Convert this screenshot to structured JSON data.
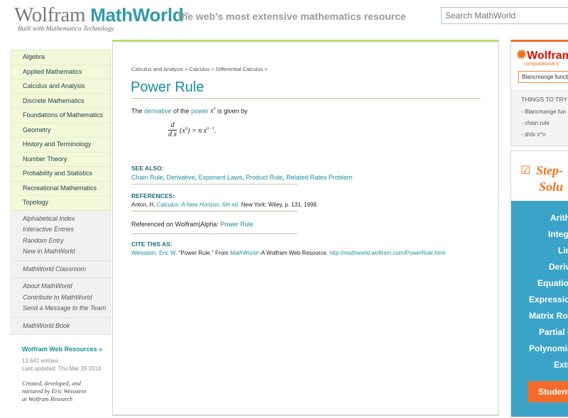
{
  "header": {
    "logo_wolfram": "Wolfram",
    "logo_mathworld": "MathW",
    "logo_mathworld_o": "o",
    "logo_mathworld_rest": "rld",
    "logo_tm": "™",
    "logo_subtitle": "Built with Mathematica Technology",
    "tagline": "the web's most extensive mathematics resource",
    "search_placeholder": "Search MathWorld"
  },
  "sidebar": {
    "topics": [
      "Algebra",
      "Applied Mathematics",
      "Calculus and Analysis",
      "Discrete Mathematics",
      "Foundations of Mathematics",
      "Geometry",
      "History and Terminology",
      "Number Theory",
      "Probability and Statistics",
      "Recreational Mathematics",
      "Topology"
    ],
    "links_alpha": "Alphabetical Index",
    "links_interactive": "Interactive Entries",
    "links_random": "Random Entry",
    "links_new_prefix": "New in ",
    "links_new_em": "MathWorld",
    "classroom_em": "MathWorld",
    "classroom_rest": " Classroom",
    "about_prefix": "About ",
    "about_em": "MathWorld",
    "contribute_prefix": "Contribute to ",
    "contribute_em": "MathWorld",
    "send": "Send a Message to the Team",
    "book_em": "MathWorld",
    "book_rest": " Book",
    "web_resources": "Wolfram Web Resources »",
    "entries": "13,641 entries",
    "last_updated": "Last updated: Thu Mar 29 2018",
    "credit_1": "Created, developed, and",
    "credit_2": "nurtured by Eric Weisstein",
    "credit_3": "at Wolfram Research"
  },
  "main": {
    "breadcrumb": [
      "Calculus and Analysis",
      "Calculus",
      "Differential Calculus"
    ],
    "breadcrumb_sep": " > ",
    "title": "Power Rule",
    "intro_the": "The ",
    "intro_link1": "derivative",
    "intro_of": " of the ",
    "intro_link2": "power",
    "intro_var": "x",
    "intro_exp": "n",
    "intro_end": " is given by",
    "eq_num": "d",
    "eq_den": "d x",
    "eq_body": "(x",
    "eq_body_exp": "n",
    "eq_mid": ") = n x",
    "eq_rhs_exp": "n−1",
    "eq_end": ".",
    "see_also_head": "SEE ALSO:",
    "see_also": [
      "Chain Rule",
      "Derivative",
      "Exponent Laws",
      "Product Rule",
      "Related Rates Problem"
    ],
    "see_also_sep": ", ",
    "references_head": "REFERENCES:",
    "ref_author": "Anton, H. ",
    "ref_book": "Calculus: A New Horizon, 6th ed.",
    "ref_rest": " New York: Wiley, p. 131, 1999.",
    "wa_ref_text": "Referenced on Wolfram|Alpha: ",
    "wa_ref_link": "Power Rule",
    "cite_head": "CITE THIS AS:",
    "cite_author": "Weisstein, Eric W.",
    "cite_title": " \"Power Rule.\" From ",
    "cite_em": "MathWorld",
    "cite_mid": "--A Wolfram Web Resource. ",
    "cite_url": "http://mathworld.wolfram.com/PowerRule.html"
  },
  "wolfram_alpha": {
    "logo": "Wolfram",
    "sub": "computational k",
    "input": "Blancmange functio",
    "things_to_try": "THINGS TO TRY",
    "items": [
      "Blancmange fun",
      "chain rule",
      "d/dx x^n"
    ]
  },
  "step_by_step": {
    "title_1": "Step-",
    "title_2": "Solu",
    "items": [
      "Arith",
      "Integ",
      "Lin",
      "Deriv",
      "Equatio",
      "Expressio",
      "Matrix Row",
      "Partial F",
      "Polynomia",
      "Extr"
    ],
    "cta": "Student"
  },
  "colors": {
    "accent_teal": "#1a8fa0",
    "green_top": "#b8dd6c",
    "orange": "#f26b2a",
    "step_blue": "#3ba3c7"
  }
}
